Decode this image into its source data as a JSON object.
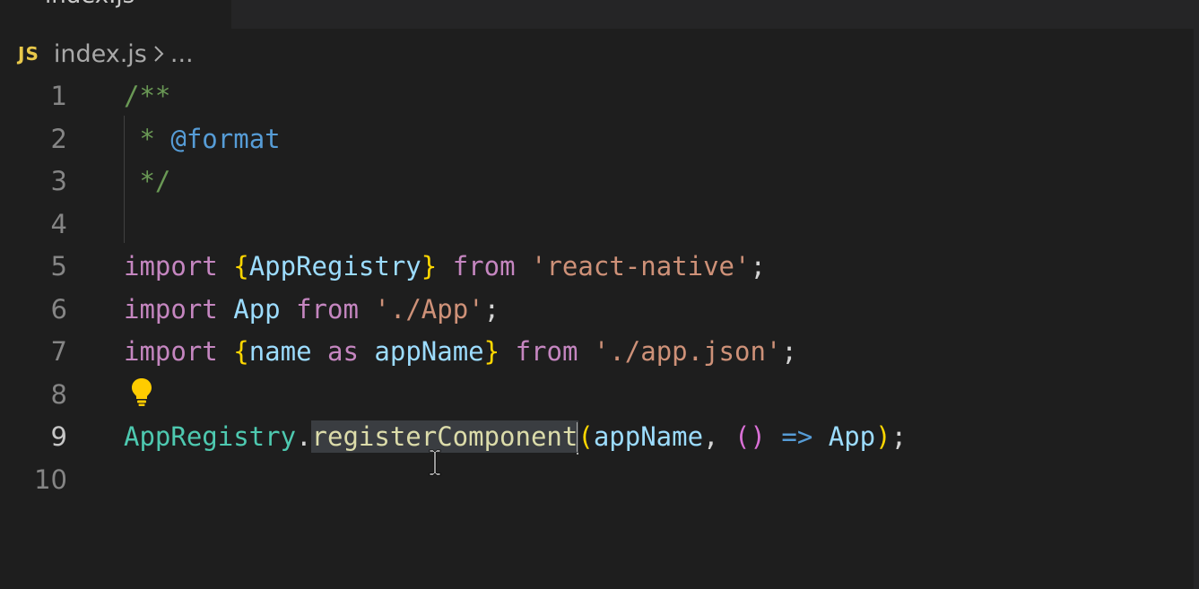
{
  "tab": {
    "label": "index.js"
  },
  "breadcrumb": {
    "badge": "JS",
    "file": "index.js",
    "ellipsis": "..."
  },
  "colors": {
    "background": "#1e1e1e",
    "comment": "#6a9955",
    "keyword": "#c586c0",
    "string": "#ce9178",
    "variable": "#9cdcfe",
    "class": "#4ec9b0",
    "function": "#dcdcaa",
    "bracket_gold": "#ffd700",
    "bracket_purple": "#da70d6",
    "selection": "#3a3d41"
  },
  "icons": {
    "breadcrumb_separator": "chevron-right-icon",
    "code_action": "lightbulb-icon",
    "pointer": "text-cursor-icon"
  },
  "editor": {
    "active_line": 9,
    "line_numbers": [
      "1",
      "2",
      "3",
      "4",
      "5",
      "6",
      "7",
      "8",
      "9",
      "10"
    ],
    "lines": {
      "l1": {
        "comment_open": "/**"
      },
      "l2": {
        "star": " * ",
        "tag": "@format"
      },
      "l3": {
        "comment_close": " */"
      },
      "l5": {
        "import_kw": "import",
        "brace_open": "{",
        "name": "AppRegistry",
        "brace_close": "}",
        "from_kw": "from",
        "source": "'react-native'",
        "semi": ";"
      },
      "l6": {
        "import_kw": "import",
        "name": "App",
        "from_kw": "from",
        "source": "'./App'",
        "semi": ";"
      },
      "l7": {
        "import_kw": "import",
        "brace_open": "{",
        "name": "name",
        "as_kw": "as",
        "alias": "appName",
        "brace_close": "}",
        "from_kw": "from",
        "source": "'./app.json'",
        "semi": ";"
      },
      "l9": {
        "object": "AppRegistry",
        "dot": ".",
        "method": "registerComponent",
        "paren_open": "(",
        "arg": "appName",
        "comma": ",",
        "arrow_parens": "()",
        "arrow": "=>",
        "ret": "App",
        "paren_close": ")",
        "semi": ";"
      }
    }
  }
}
